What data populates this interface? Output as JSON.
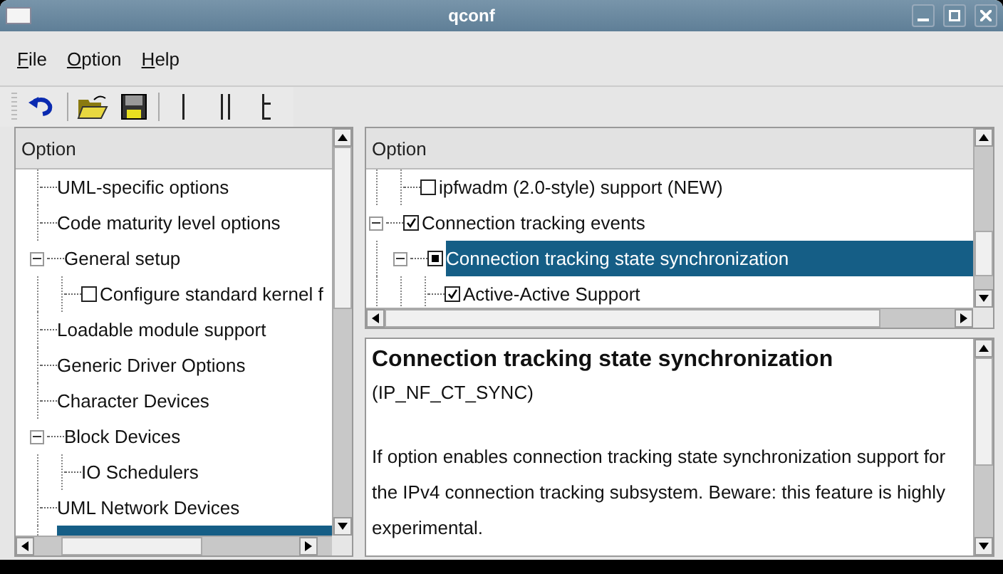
{
  "window": {
    "title": "qconf"
  },
  "menu": [
    "File",
    "Option",
    "Help"
  ],
  "toolbar": [
    {
      "kind": "undo"
    },
    {
      "kind": "separator"
    },
    {
      "kind": "open"
    },
    {
      "kind": "save"
    },
    {
      "kind": "separator"
    },
    {
      "kind": "single"
    },
    {
      "kind": "split"
    },
    {
      "kind": "full"
    }
  ],
  "left_tree": {
    "header": "Option",
    "items": [
      {
        "label": "UML-specific options"
      },
      {
        "label": "Code maturity level options"
      },
      {
        "label": "General setup",
        "expanded": true,
        "children": [
          {
            "label": "Configure standard kernel f",
            "checked": false
          }
        ]
      },
      {
        "label": "Loadable module support"
      },
      {
        "label": "Generic Driver Options"
      },
      {
        "label": "Character Devices"
      },
      {
        "label": "Block Devices",
        "expanded": true,
        "children": [
          {
            "label": "IO Schedulers"
          }
        ]
      },
      {
        "label": "UML Network Devices"
      },
      {
        "selected": true
      }
    ]
  },
  "right_tree": {
    "header": "Option",
    "items": [
      {
        "kind": "continued",
        "children": [
          {
            "label": "ipfwadm (2.0-style) support (NEW)",
            "checked": false
          }
        ]
      },
      {
        "label": "Connection tracking events",
        "checked": true,
        "expanded": true,
        "children": [
          {
            "label": "Connection tracking state synchronization",
            "checked": true,
            "module": true,
            "selected": true,
            "expanded": true,
            "children": [
              {
                "label": "Active-Active Support",
                "checked": true
              }
            ]
          }
        ]
      }
    ]
  },
  "help": {
    "title": "Connection tracking state synchronization",
    "symbol": "(IP_NF_CT_SYNC)",
    "text": "If option enables connection tracking state synchronization support for the IPv4 connection tracking subsystem. Beware: this feature is highly experimental."
  }
}
